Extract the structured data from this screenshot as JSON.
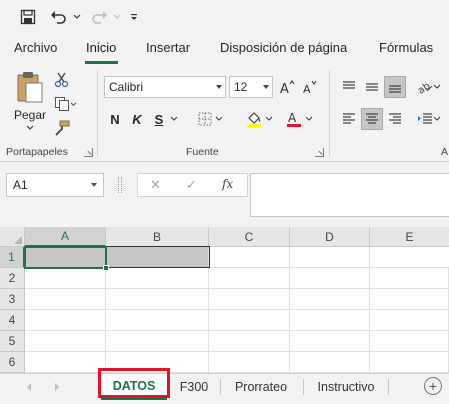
{
  "qat": {
    "save_icon": "save-icon",
    "undo_icon": "undo-icon",
    "redo_icon": "redo-icon",
    "customize_icon": "customize-qat-icon"
  },
  "ribbon_tabs": [
    "Archivo",
    "Inicio",
    "Insertar",
    "Disposición de página",
    "Fórmulas"
  ],
  "active_tab": "Inicio",
  "clipboard": {
    "paste_label": "Pegar",
    "group_label": "Portapapeles"
  },
  "font": {
    "family": "Calibri",
    "size": "12",
    "bold": "N",
    "italic": "K",
    "underline": "S",
    "group_label": "Fuente",
    "highlight_color": "#ffff00",
    "font_color": "#e0142a"
  },
  "alignment": {
    "group_label_partial": "A"
  },
  "formula_bar": {
    "name_box": "A1",
    "cancel_glyph": "✕",
    "enter_glyph": "✓",
    "fx_label": "fx",
    "value": ""
  },
  "grid": {
    "columns": [
      "A",
      "B",
      "C",
      "D",
      "E"
    ],
    "rows": [
      "1",
      "2",
      "3",
      "4",
      "5",
      "6"
    ],
    "active_cell": "A1",
    "selected_range": "A1:B1"
  },
  "sheets": {
    "tabs": [
      "DATOS",
      "F300",
      "Prorrateo",
      "Instructivo"
    ],
    "active": "DATOS",
    "add_glyph": "+"
  },
  "colors": {
    "accent": "#217346",
    "highlight_border": "#e0142a",
    "selection_fill": "#c6c6c6"
  }
}
